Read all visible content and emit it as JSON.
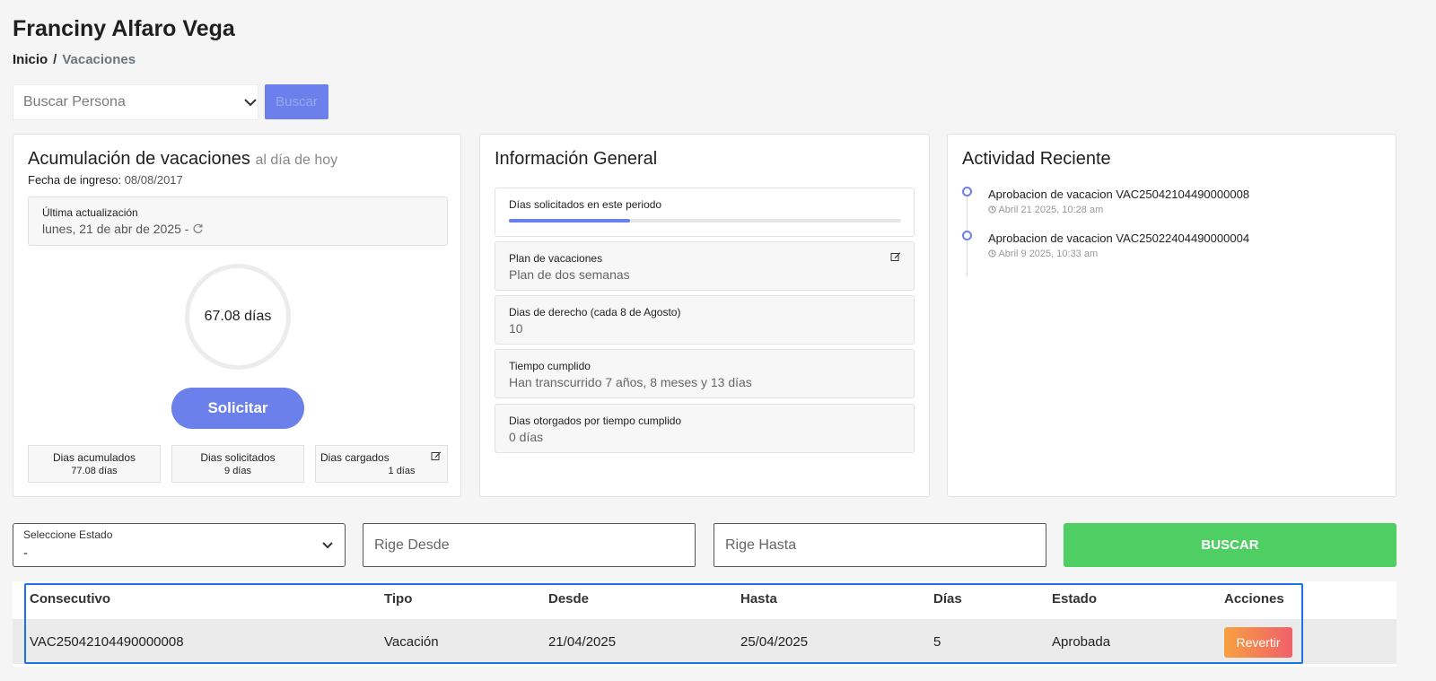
{
  "header": {
    "title": "Franciny Alfaro Vega",
    "breadcrumb": {
      "home": "Inicio",
      "separator": "/",
      "current": "Vacaciones"
    }
  },
  "search": {
    "placeholder": "Buscar Persona",
    "button": "Buscar"
  },
  "accumulation": {
    "title": "Acumulación de vacaciones",
    "subtitle": "al día de hoy",
    "fecha_label": "Fecha de ingreso:",
    "fecha_value": "08/08/2017",
    "update_label": "Última actualización",
    "update_value": "lunes, 21 de abr de 2025 -",
    "days_total": "67.08 días",
    "request_button": "Solicitar",
    "stats": [
      {
        "label": "Dias acumulados",
        "value": "77.08 días"
      },
      {
        "label": "Dias solicitados",
        "value": "9 días"
      },
      {
        "label": "Dias cargados",
        "value": "1 días"
      }
    ]
  },
  "general_info": {
    "title": "Información General",
    "period_label": "Días solicitados en este periodo",
    "period_progress_percent": 31,
    "items": [
      {
        "label": "Plan de vacaciones",
        "value": "Plan de dos semanas"
      },
      {
        "label": "Dias de derecho (cada 8 de Agosto)",
        "value": "10"
      },
      {
        "label": "Tiempo cumplido",
        "value": "Han transcurrido 7 años, 8 meses y 13 días"
      },
      {
        "label": "Dias otorgados por tiempo cumplido",
        "value": "0 días"
      }
    ]
  },
  "activity": {
    "title": "Actividad Reciente",
    "items": [
      {
        "title": "Aprobacion de vacacion VAC25042104490000008",
        "time": "Abril 21 2025, 10:28 am"
      },
      {
        "title": "Aprobacion de vacacion VAC25022404490000004",
        "time": "Abril 9 2025, 10:33 am"
      }
    ]
  },
  "filters": {
    "estado_label": "Seleccione Estado",
    "estado_value": "-",
    "desde_placeholder": "Rige Desde",
    "hasta_placeholder": "Rige Hasta",
    "search_button": "BUSCAR"
  },
  "table": {
    "headers": [
      "Consecutivo",
      "Tipo",
      "Desde",
      "Hasta",
      "Días",
      "Estado",
      "Acciones"
    ],
    "rows": [
      {
        "consecutivo": "VAC25042104490000008",
        "tipo": "Vacación",
        "desde": "21/04/2025",
        "hasta": "25/04/2025",
        "dias": "5",
        "estado": "Aprobada",
        "accion": "Revertir"
      }
    ]
  },
  "colors": {
    "primary": "#6b80ea",
    "success": "#4fce63",
    "warning_gradient_start": "#f7a040",
    "warning_gradient_end": "#f0606a"
  }
}
